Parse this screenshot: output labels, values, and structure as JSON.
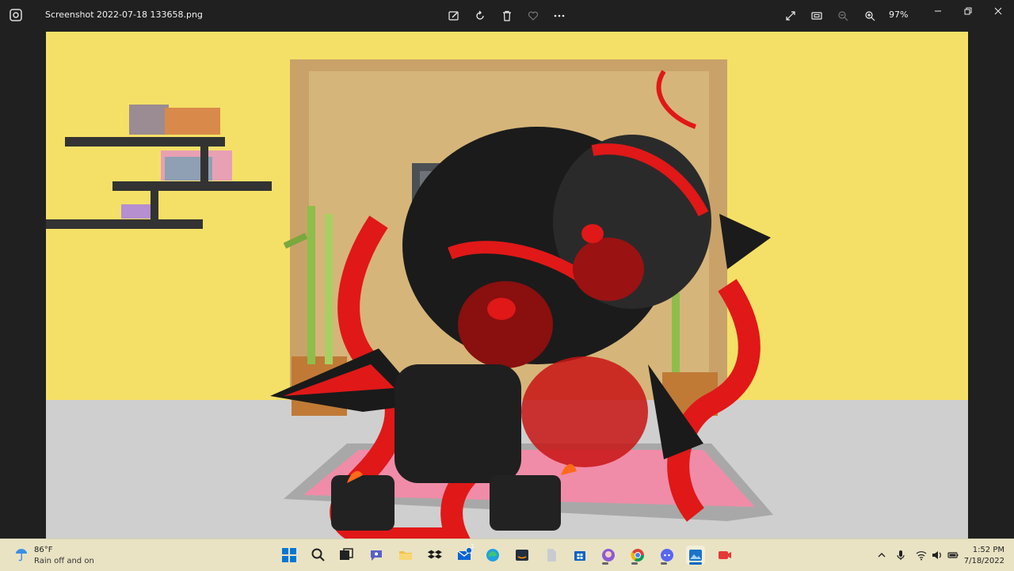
{
  "titlebar": {
    "filename": "Screenshot 2022-07-18 133658.png",
    "zoom": "97%",
    "tools": [
      "edit-icon",
      "rotate-icon",
      "delete-icon",
      "favorite-icon",
      "more-icon"
    ],
    "view_tools": [
      "fullscreen-icon",
      "fit-icon",
      "zoom-out-icon",
      "zoom-in-icon"
    ]
  },
  "taskbar": {
    "weather_temp": "86°F",
    "weather_desc": "Rain off and on",
    "time": "1:52 PM",
    "date": "7/18/2022",
    "mail_badge": "1",
    "accent": "#0067c0"
  }
}
